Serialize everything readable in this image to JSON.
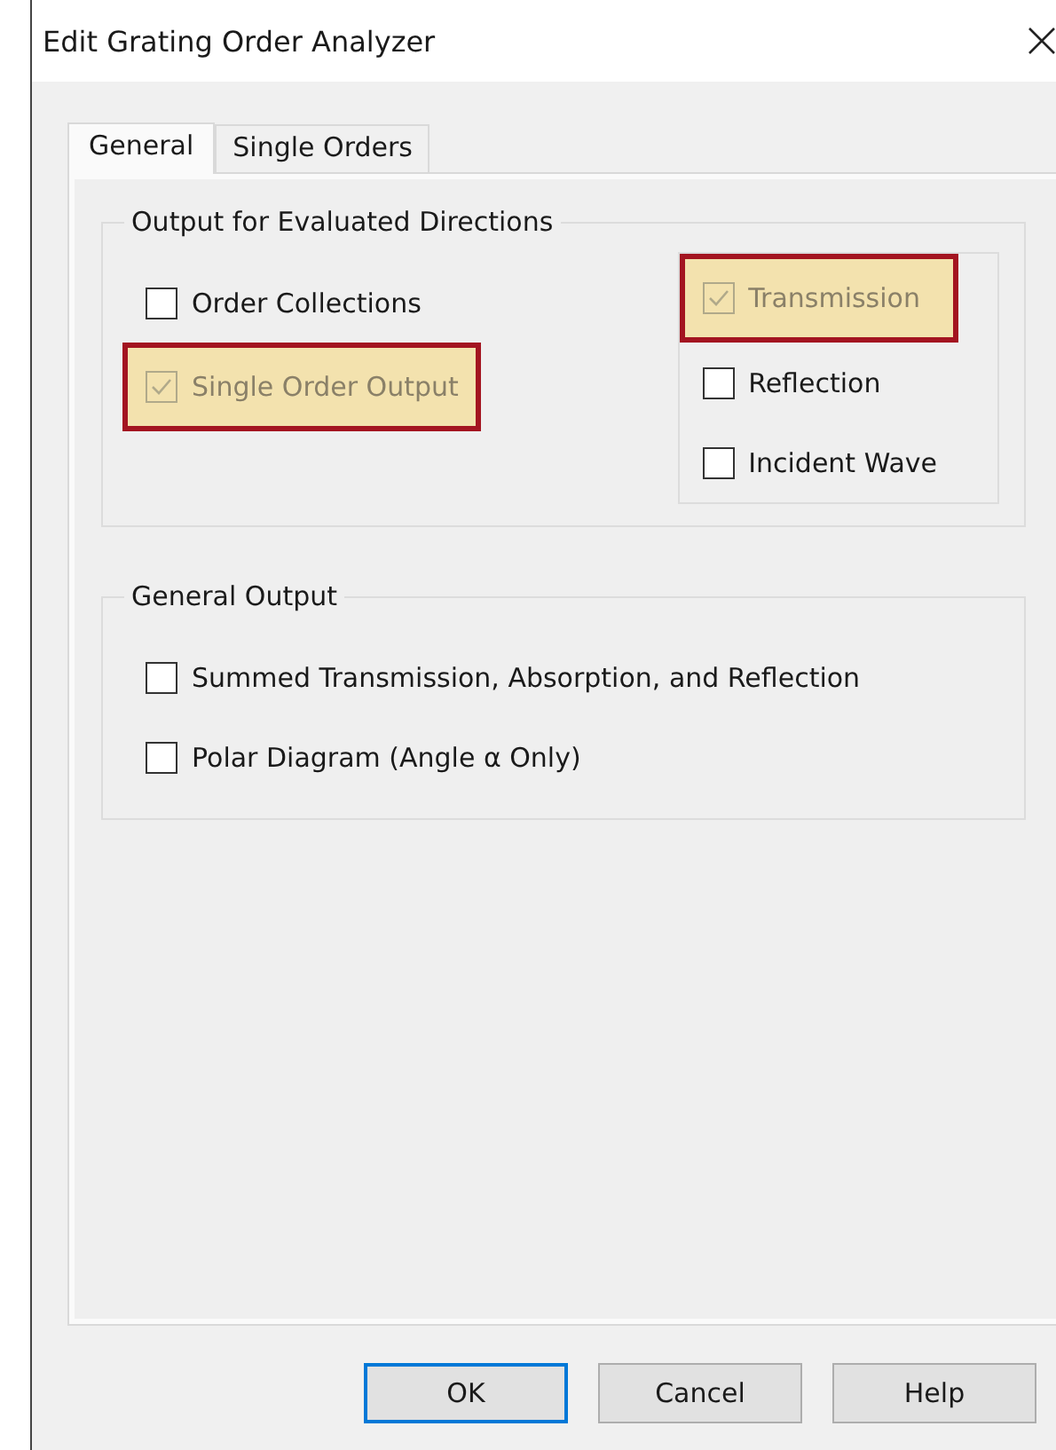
{
  "window": {
    "title": "Edit Grating Order Analyzer"
  },
  "tabs": [
    {
      "label": "General",
      "selected": true
    },
    {
      "label": "Single Orders",
      "selected": false
    }
  ],
  "groups": [
    {
      "title": "Output for Evaluated Directions",
      "options": [
        {
          "label": "Order Collections",
          "checked": false,
          "highlighted": false
        },
        {
          "label": "Single Order Output",
          "checked": true,
          "highlighted": true
        }
      ],
      "side_options": [
        {
          "label": "Transmission",
          "checked": true,
          "highlighted": true
        },
        {
          "label": "Reflection",
          "checked": false,
          "highlighted": false
        },
        {
          "label": "Incident Wave",
          "checked": false,
          "highlighted": false
        }
      ]
    },
    {
      "title": "General Output",
      "options": [
        {
          "label": "Summed Transmission, Absorption, and Reflection",
          "checked": false,
          "highlighted": false
        },
        {
          "label": "Polar Diagram (Angle α Only)",
          "checked": false,
          "highlighted": false
        }
      ]
    }
  ],
  "buttons": [
    {
      "label": "OK",
      "default": true
    },
    {
      "label": "Cancel",
      "default": false
    },
    {
      "label": "Help",
      "default": false
    }
  ]
}
